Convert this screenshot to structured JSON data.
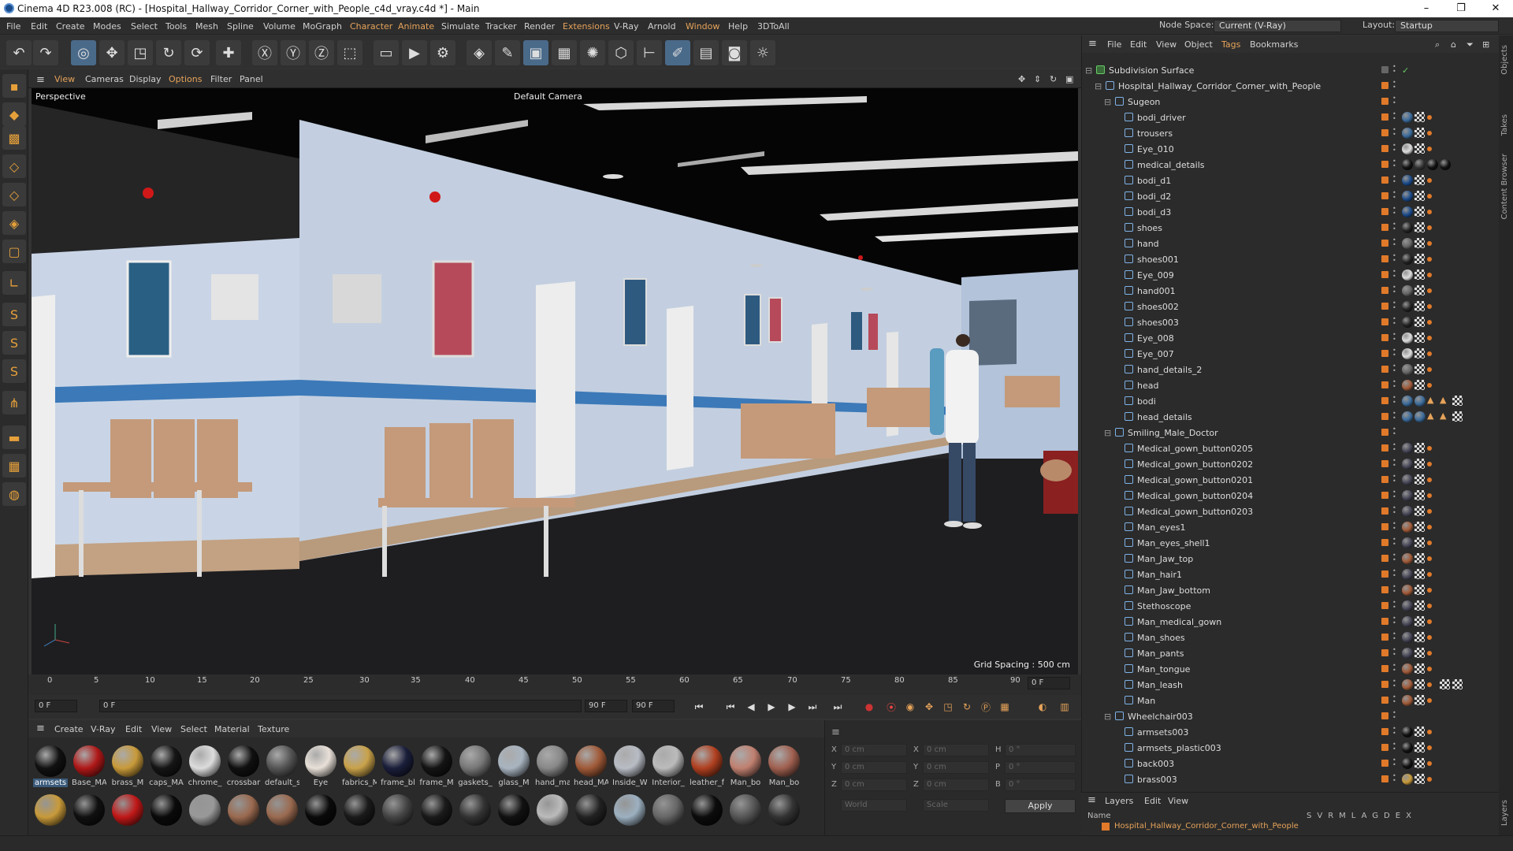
{
  "title": "Cinema 4D R23.008 (RC) - [Hospital_Hallway_Corridor_Corner_with_People_c4d_vray.c4d *] - Main",
  "menu": [
    "File",
    "Edit",
    "Create",
    "Modes",
    "Select",
    "Tools",
    "Mesh",
    "Spline",
    "Volume",
    "MoGraph",
    "Character",
    "Animate",
    "Simulate",
    "Tracker",
    "Render",
    "Extensions",
    "V-Ray",
    "Arnold",
    "Window",
    "Help",
    "3DToAll"
  ],
  "node_space_label": "Node Space:",
  "node_space_value": "Current (V-Ray)",
  "layout_label": "Layout:",
  "layout_value": "Startup",
  "viewport_menu": [
    "View",
    "Cameras",
    "Display",
    "Options",
    "Filter",
    "Panel"
  ],
  "viewport_label": "Perspective",
  "camera_label": "Default Camera",
  "grid_spacing": "Grid Spacing : 500 cm",
  "timeline_ticks": [
    "0",
    "5",
    "10",
    "15",
    "20",
    "25",
    "30",
    "35",
    "40",
    "45",
    "50",
    "55",
    "60",
    "65",
    "70",
    "75",
    "80",
    "85",
    "90"
  ],
  "timeline_end": "0 F",
  "frame_current": "0 F",
  "frame_start": "0 F",
  "frame_end": "90 F",
  "frame_end2": "90 F",
  "material_menu": [
    "Create",
    "V-Ray",
    "Edit",
    "View",
    "Select",
    "Material",
    "Texture"
  ],
  "materials": [
    {
      "label": "armsets",
      "color": "#111"
    },
    {
      "label": "Base_MA",
      "color": "#b01818"
    },
    {
      "label": "brass_M",
      "color": "#c89a3a"
    },
    {
      "label": "caps_MA",
      "color": "#151515"
    },
    {
      "label": "chrome_",
      "color": "#dcdcdc"
    },
    {
      "label": "crossbar",
      "color": "#101010"
    },
    {
      "label": "default_s",
      "color": "#555"
    },
    {
      "label": "Eye",
      "color": "#e8e0d8"
    },
    {
      "label": "fabrics_M",
      "color": "#c9a24a"
    },
    {
      "label": "frame_bl",
      "color": "#1a1e3a"
    },
    {
      "label": "frame_M",
      "color": "#141414"
    },
    {
      "label": "gaskets_",
      "color": "#777"
    },
    {
      "label": "glass_M",
      "color": "#a8b4c0"
    },
    {
      "label": "hand_ma",
      "color": "#888"
    },
    {
      "label": "head_MA",
      "color": "#a05a38"
    },
    {
      "label": "Inside_W",
      "color": "#b8bcc4"
    },
    {
      "label": "Interior_",
      "color": "#bbb"
    },
    {
      "label": "leather_f",
      "color": "#b04020"
    },
    {
      "label": "Man_bo",
      "color": "#c08070"
    },
    {
      "label": "Man_bo",
      "color": "#a06050"
    }
  ],
  "materials_row2": [
    "#c89a3a",
    "#101010",
    "#c01818",
    "#0a0a0a",
    "#999",
    "#9a6a50",
    "#9a6a50",
    "#0a0a0a",
    "#1a1a1a",
    "#444",
    "#1a1a1a",
    "#333",
    "#111",
    "#bbb",
    "#222",
    "#9cb0c0",
    "#666",
    "#0c0c0c",
    "#555",
    "#333"
  ],
  "coords": {
    "x_label": "X",
    "y_label": "Y",
    "z_label": "Z",
    "x_val": "0 cm",
    "y_val": "0 cm",
    "z_val": "0 cm",
    "x2_val": "0 cm",
    "y2_val": "0 cm",
    "z2_val": "0 cm",
    "h_label": "H",
    "p_label": "P",
    "b_label": "B",
    "h_val": "0 °",
    "p_val": "0 °",
    "b_val": "0 °",
    "world": "World",
    "scale": "Scale",
    "apply": "Apply"
  },
  "object_menu": [
    "File",
    "Edit",
    "View",
    "Object",
    "Tags",
    "Bookmarks"
  ],
  "objects": [
    {
      "name": "Subdivision Surface",
      "level": 0,
      "tags": []
    },
    {
      "name": "Hospital_Hallway_Corridor_Corner_with_People",
      "level": 1,
      "tags": []
    },
    {
      "name": "Sugeon",
      "level": 2,
      "tags": []
    },
    {
      "name": "bodi_driver",
      "level": 3,
      "tags": [
        "#3a6a9a",
        "chk",
        "dot"
      ]
    },
    {
      "name": "trousers",
      "level": 3,
      "tags": [
        "#3a6a9a",
        "chk",
        "dot"
      ]
    },
    {
      "name": "Eye_010",
      "level": 3,
      "tags": [
        "#ddd",
        "chk",
        "dot"
      ]
    },
    {
      "name": "medical_details",
      "level": 3,
      "tags": [
        "#111",
        "#333",
        "#111",
        "#111"
      ]
    },
    {
      "name": "bodi_d1",
      "level": 3,
      "tags": [
        "#1a4a8a",
        "chk",
        "dot"
      ]
    },
    {
      "name": "bodi_d2",
      "level": 3,
      "tags": [
        "#1a4a8a",
        "chk",
        "dot"
      ]
    },
    {
      "name": "bodi_d3",
      "level": 3,
      "tags": [
        "#1a4a8a",
        "chk",
        "dot"
      ]
    },
    {
      "name": "shoes",
      "level": 3,
      "tags": [
        "#222",
        "chk",
        "dot"
      ]
    },
    {
      "name": "hand",
      "level": 3,
      "tags": [
        "#666",
        "chk",
        "dot"
      ]
    },
    {
      "name": "shoes001",
      "level": 3,
      "tags": [
        "#222",
        "chk",
        "dot"
      ]
    },
    {
      "name": "Eye_009",
      "level": 3,
      "tags": [
        "#ddd",
        "chk",
        "dot"
      ]
    },
    {
      "name": "hand001",
      "level": 3,
      "tags": [
        "#666",
        "chk",
        "dot"
      ]
    },
    {
      "name": "shoes002",
      "level": 3,
      "tags": [
        "#222",
        "chk",
        "dot"
      ]
    },
    {
      "name": "shoes003",
      "level": 3,
      "tags": [
        "#222",
        "chk",
        "dot"
      ]
    },
    {
      "name": "Eye_008",
      "level": 3,
      "tags": [
        "#ddd",
        "chk",
        "dot"
      ]
    },
    {
      "name": "Eye_007",
      "level": 3,
      "tags": [
        "#ddd",
        "chk",
        "dot"
      ]
    },
    {
      "name": "hand_details_2",
      "level": 3,
      "tags": [
        "#666",
        "chk",
        "dot"
      ]
    },
    {
      "name": "head",
      "level": 3,
      "tags": [
        "#a05a38",
        "chk",
        "dot"
      ]
    },
    {
      "name": "bodi",
      "level": 3,
      "tags": [
        "#3a6a9a",
        "#3a6a9a",
        "tri",
        "tri",
        "chk"
      ]
    },
    {
      "name": "head_details",
      "level": 3,
      "tags": [
        "#3a6a9a",
        "#3a6a9a",
        "tri",
        "tri",
        "chk"
      ]
    },
    {
      "name": "Smiling_Male_Doctor",
      "level": 2,
      "tags": []
    },
    {
      "name": "Medical_gown_button0205",
      "level": 3,
      "tags": [
        "#445",
        "chk",
        "dot"
      ]
    },
    {
      "name": "Medical_gown_button0202",
      "level": 3,
      "tags": [
        "#445",
        "chk",
        "dot"
      ]
    },
    {
      "name": "Medical_gown_button0201",
      "level": 3,
      "tags": [
        "#445",
        "chk",
        "dot"
      ]
    },
    {
      "name": "Medical_gown_button0204",
      "level": 3,
      "tags": [
        "#445",
        "chk",
        "dot"
      ]
    },
    {
      "name": "Medical_gown_button0203",
      "level": 3,
      "tags": [
        "#445",
        "chk",
        "dot"
      ]
    },
    {
      "name": "Man_eyes1",
      "level": 3,
      "tags": [
        "#a05a38",
        "chk",
        "dot"
      ]
    },
    {
      "name": "Man_eyes_shell1",
      "level": 3,
      "tags": [
        "#445",
        "chk",
        "dot"
      ]
    },
    {
      "name": "Man_Jaw_top",
      "level": 3,
      "tags": [
        "#a05a38",
        "chk",
        "dot"
      ]
    },
    {
      "name": "Man_hair1",
      "level": 3,
      "tags": [
        "#445",
        "chk",
        "dot"
      ]
    },
    {
      "name": "Man_Jaw_bottom",
      "level": 3,
      "tags": [
        "#a05a38",
        "chk",
        "dot"
      ]
    },
    {
      "name": "Stethoscope",
      "level": 3,
      "tags": [
        "#445",
        "chk",
        "dot"
      ]
    },
    {
      "name": "Man_medical_gown",
      "level": 3,
      "tags": [
        "#445",
        "chk",
        "dot"
      ]
    },
    {
      "name": "Man_shoes",
      "level": 3,
      "tags": [
        "#445",
        "chk",
        "dot"
      ]
    },
    {
      "name": "Man_pants",
      "level": 3,
      "tags": [
        "#445",
        "chk",
        "dot"
      ]
    },
    {
      "name": "Man_tongue",
      "level": 3,
      "tags": [
        "#a05a38",
        "chk",
        "dot"
      ]
    },
    {
      "name": "Man_leash",
      "level": 3,
      "tags": [
        "#a05a38",
        "chk",
        "dot",
        "chk",
        "chk"
      ]
    },
    {
      "name": "Man",
      "level": 3,
      "tags": [
        "#a05a38",
        "chk",
        "dot"
      ]
    },
    {
      "name": "Wheelchair003",
      "level": 2,
      "tags": []
    },
    {
      "name": "armsets003",
      "level": 3,
      "tags": [
        "#111",
        "chk",
        "dot"
      ]
    },
    {
      "name": "armsets_plastic003",
      "level": 3,
      "tags": [
        "#111",
        "chk",
        "dot"
      ]
    },
    {
      "name": "back003",
      "level": 3,
      "tags": [
        "#111",
        "chk",
        "dot"
      ]
    },
    {
      "name": "brass003",
      "level": 3,
      "tags": [
        "#c89a3a",
        "chk",
        "dot"
      ]
    }
  ],
  "layers_menu": [
    "Layers",
    "Edit",
    "View"
  ],
  "layers_header": "Name",
  "layers_cols": [
    "S",
    "V",
    "R",
    "M",
    "L",
    "A",
    "G",
    "D",
    "E",
    "X"
  ],
  "layers_row": "Hospital_Hallway_Corridor_Corner_with_People",
  "side_tabs": [
    "Objects",
    "Takes",
    "Content Browser",
    "Layers"
  ],
  "colors": {
    "accent": "#e6a35a",
    "selection": "#4a6a8a",
    "orange": "#e07a2a"
  }
}
